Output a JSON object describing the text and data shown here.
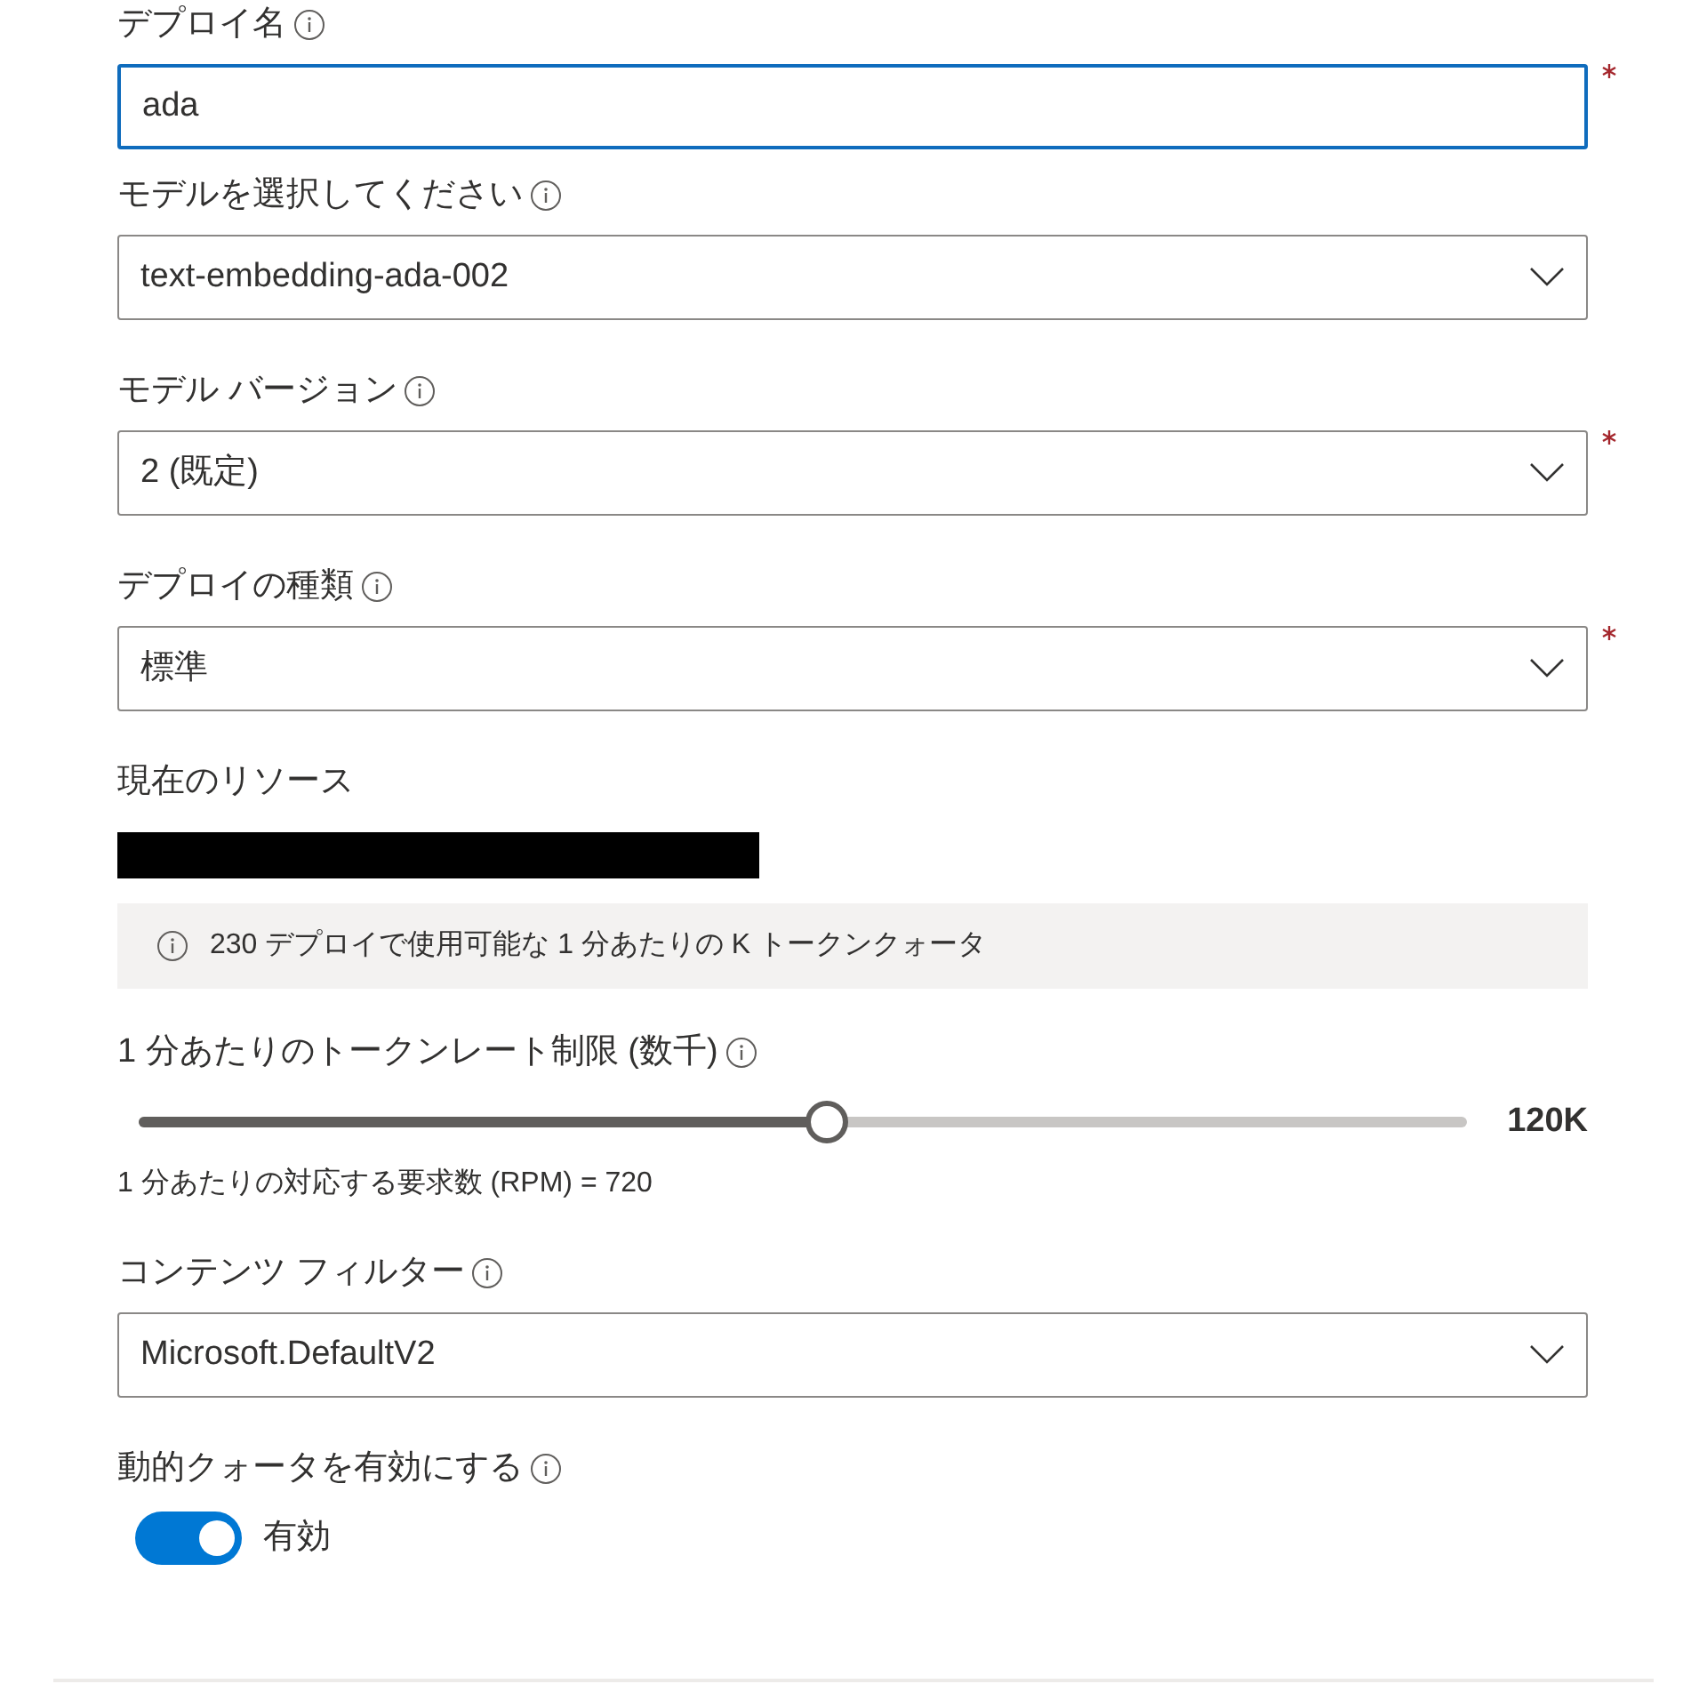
{
  "form": [
    {
      "kind": "text",
      "label": "デプロイ名",
      "info": true,
      "value": "ada",
      "required": true,
      "focused": true
    },
    {
      "kind": "dropdown",
      "label": "モデルを選択してください",
      "info": true,
      "value": "text-embedding-ada-002",
      "required": false,
      "focused": false
    },
    {
      "kind": "dropdown",
      "label": "モデル バージョン",
      "info": true,
      "value": "2 (既定)",
      "required": true,
      "focused": false
    },
    {
      "kind": "dropdown",
      "label": "デプロイの種類",
      "info": true,
      "value": "標準",
      "required": true,
      "focused": false
    },
    {
      "kind": "resource",
      "label": "現在のリソース",
      "info": false,
      "redacted": true
    },
    {
      "kind": "banner",
      "text": "230 デプロイで使用可能な 1 分あたりの K トークンクォータ"
    },
    {
      "kind": "slider",
      "label": "1 分あたりのトークンレート制限 (数千)",
      "info": true,
      "level": 0.518,
      "reading": "120K",
      "note": "1 分あたりの対応する要求数 (RPM) = 720"
    },
    {
      "kind": "dropdown",
      "label": "コンテンツ フィルター",
      "info": true,
      "value": "Microsoft.DefaultV2",
      "required": false,
      "focused": false
    },
    {
      "kind": "toggle",
      "label": "動的クォータを有効にする",
      "info": true,
      "on": true,
      "state_text": "有効"
    }
  ]
}
